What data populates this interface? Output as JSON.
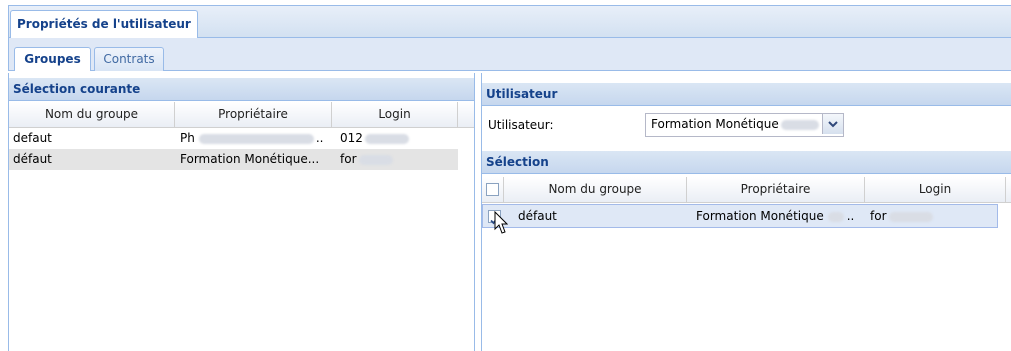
{
  "window": {
    "tab_title": "Propriétés de l'utilisateur"
  },
  "tabs": [
    {
      "label": "Groupes",
      "active": true
    },
    {
      "label": "Contrats",
      "active": false
    }
  ],
  "left_panel": {
    "title": "Sélection courante",
    "columns": [
      "Nom du groupe",
      "Propriétaire",
      "Login"
    ],
    "rows": [
      {
        "group": "defaut",
        "owner": "Ph",
        "owner_suffix": "..",
        "login": "012"
      },
      {
        "group": "défaut",
        "owner": "Formation Monétique...",
        "owner_suffix": "",
        "login": "for"
      }
    ]
  },
  "right_panel": {
    "user_section_title": "Utilisateur",
    "user_label": "Utilisateur:",
    "user_value": "Formation Monétique",
    "selection_title": "Sélection",
    "columns": [
      "Nom du groupe",
      "Propriétaire",
      "Login"
    ],
    "rows": [
      {
        "group": "défaut",
        "owner": "Formation Monétique",
        "owner_suffix": "..",
        "login": "for",
        "checked": true
      }
    ]
  },
  "colors": {
    "accent": "#15428b",
    "border": "#99bbe8",
    "header_bg": "#c6d7ee",
    "selected_row": "#dfe8f6"
  },
  "icons": {
    "combo_arrow": "chevron-down-icon",
    "checkbox": "checkbox-icon",
    "cursor": "mouse-cursor-icon"
  }
}
